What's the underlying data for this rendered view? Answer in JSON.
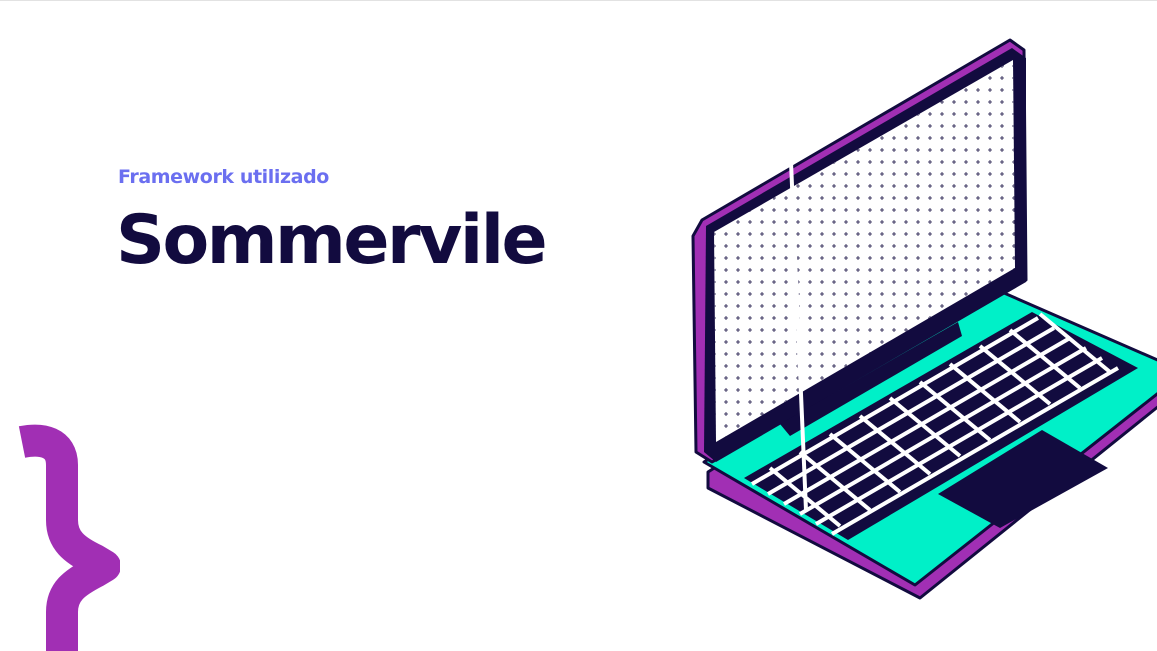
{
  "slide": {
    "subtitle": "Framework utilizado",
    "title": "Sommervile"
  },
  "colors": {
    "accent_purple": "#a12fb4",
    "accent_teal": "#00f0c8",
    "navy": "#120b3f",
    "subtitle_blue": "#6b6ff0",
    "background": "#ffffff"
  },
  "icons": {
    "brace": "curly-brace-icon",
    "illustration": "laptop-icon"
  }
}
